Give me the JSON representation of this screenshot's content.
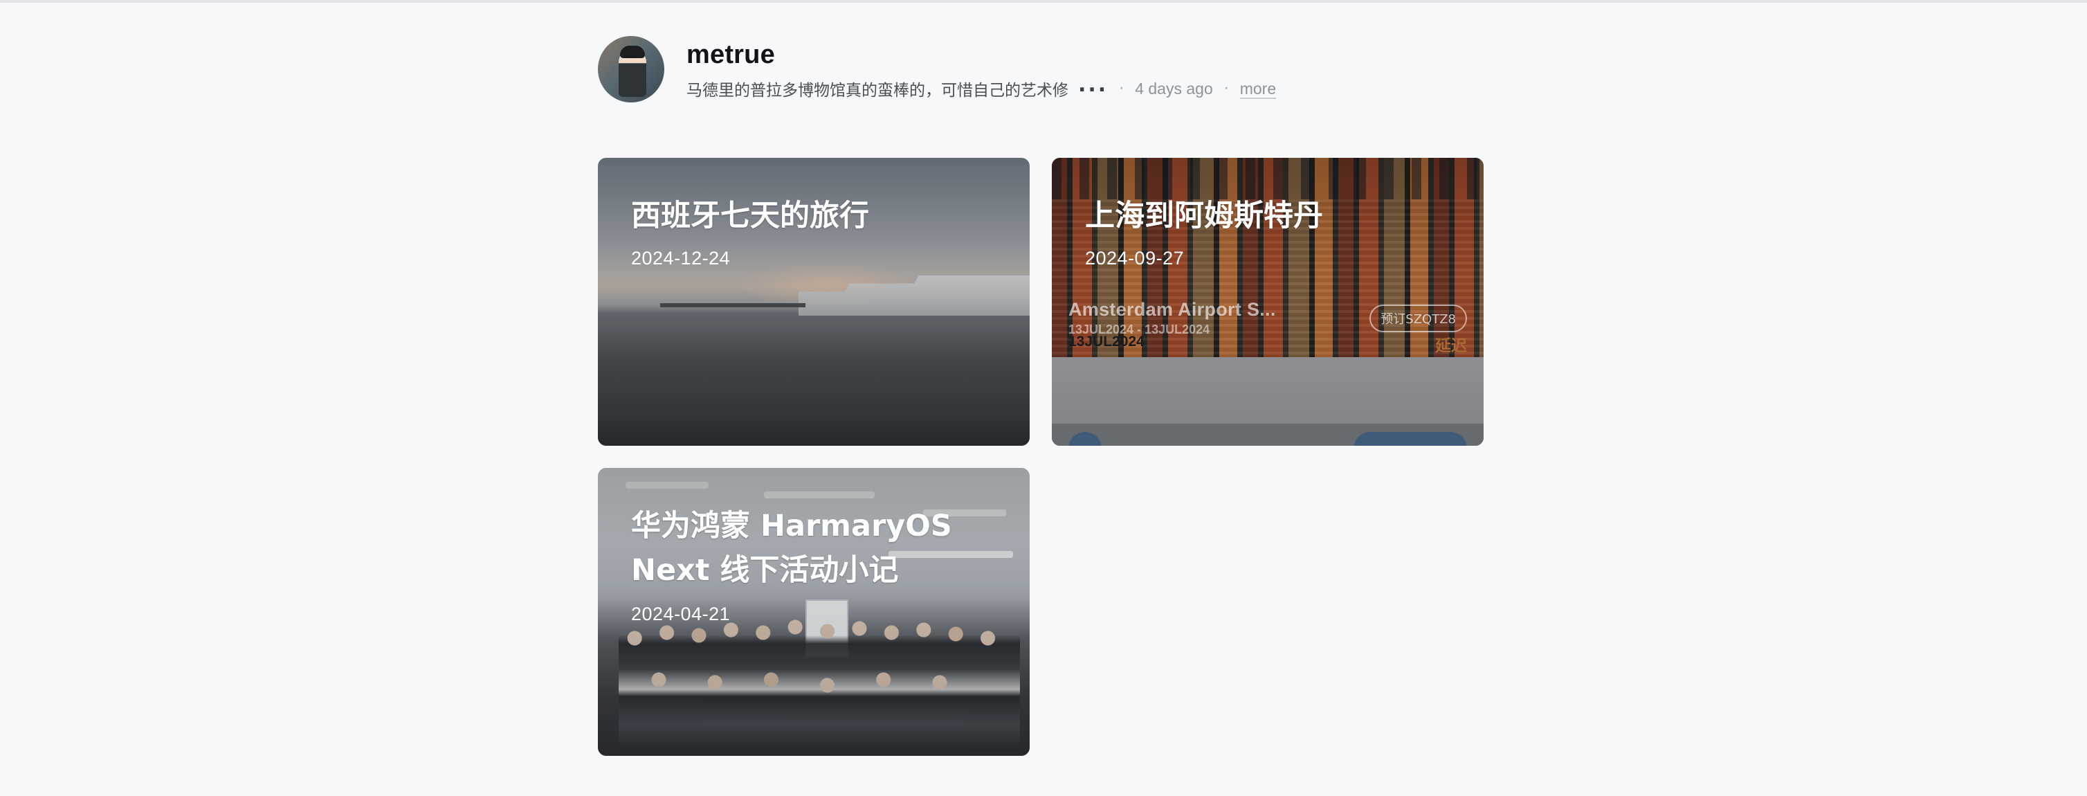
{
  "profile": {
    "username": "metrue",
    "bio": "马德里的普拉多博物馆真的蛮棒的，可惜自己的艺术修",
    "ellipsis": "...",
    "separator": "·",
    "time": "4 days ago",
    "more_label": "more"
  },
  "posts": [
    {
      "title": "西班牙七天的旅行",
      "date": "2024-12-24"
    },
    {
      "title": "上海到阿姆斯特丹",
      "date": "2024-09-27",
      "boarding_pass": {
        "name": "Amsterdam Airport S...",
        "range": "13JUL2024 - 13JUL2024",
        "button": "预订SZQTZ8",
        "date": "13JUL2024",
        "status": "延迟"
      }
    },
    {
      "title": "华为鸿蒙 HarmaryOS Next 线下活动小记",
      "date": "2024-04-21"
    }
  ],
  "colors": {
    "background": "#f7f8fa",
    "status_delay": "#a86a32"
  }
}
